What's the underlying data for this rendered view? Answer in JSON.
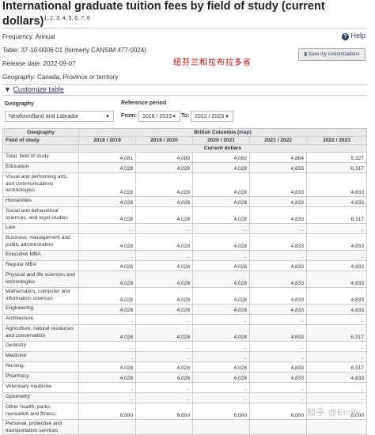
{
  "page": {
    "title": "International graduate tuition fees by field of study (current dollars)",
    "footnotes": "1, 2, 3, 4, 5, 6, 7, 8",
    "help_label": "Help",
    "frequency": "Frequency: Annual",
    "table_id": "Table: 37-10-0006-01 (formerly CANSIM 477-0024)",
    "release_date": "Release date: 2022-09-07",
    "geography_prefix": "Geography:",
    "geography_value": " Canada, Province or territory",
    "save_button": "Save my customizations",
    "chinese_annotation": "纽芬兰和拉布拉多省",
    "customize_label": "Customize table"
  },
  "filters": {
    "geography_label": "Geography",
    "geography_value": "Newfoundland and Labrador",
    "reference_label": "Reference period",
    "from_label": "From:",
    "from_value": "2018 / 2019",
    "to_label": "To:",
    "to_value": "2022 / 2023"
  },
  "table": {
    "geo_header": "Geography",
    "region": "British Columbia",
    "map_link": "(map)",
    "field_header": "Field of study",
    "years": [
      "2018 / 2019",
      "2019 / 2020",
      "2020 / 2021",
      "2021 / 2022",
      "2022 / 2023"
    ],
    "unit": "Current dollars",
    "rows": [
      {
        "label": "Total, field of study",
        "values": [
          "4,081",
          "4,089",
          "4,082",
          "4,864",
          "5,327"
        ]
      },
      {
        "label": "Education",
        "values": [
          "4,028",
          "4,028",
          "4,028",
          "4,833",
          "6,317"
        ]
      },
      {
        "label": "Visual and performing arts, and communications technologies",
        "values": [
          "4,028",
          "4,028",
          "4,028",
          "4,833",
          "4,833"
        ]
      },
      {
        "label": "Humanities",
        "values": [
          "4,028",
          "4,028",
          "4,028",
          "4,833",
          "4,833"
        ]
      },
      {
        "label": "Social and behavioural sciences, and legal studies",
        "values": [
          "4,028",
          "4,028",
          "4,028",
          "4,833",
          "6,317"
        ]
      },
      {
        "label": "Law",
        "values": [
          "..",
          "..",
          "..",
          "..",
          ".."
        ]
      },
      {
        "label": "Business, management and public administration",
        "values": [
          "4,028",
          "4,028",
          "4,028",
          "4,833",
          "4,833"
        ]
      },
      {
        "label": "Executive MBA",
        "values": [
          "..",
          "..",
          "..",
          "..",
          ".."
        ]
      },
      {
        "label": "Regular MBA",
        "values": [
          "4,028",
          "4,028",
          "4,028",
          "4,833",
          "4,833"
        ]
      },
      {
        "label": "Physical and life sciences and technologies",
        "values": [
          "4,028",
          "4,028",
          "4,028",
          "4,833",
          "4,833"
        ]
      },
      {
        "label": "Mathematics, computer and information sciences",
        "values": [
          "4,028",
          "4,028",
          "4,028",
          "4,833",
          "4,833"
        ]
      },
      {
        "label": "Engineering",
        "values": [
          "4,028",
          "4,028",
          "4,028",
          "4,833",
          "4,833"
        ]
      },
      {
        "label": "Architecture",
        "values": [
          "..",
          "..",
          "..",
          "..",
          ".."
        ]
      },
      {
        "label": "Agriculture, natural resources and conservation",
        "values": [
          "4,028",
          "4,028",
          "4,028",
          "4,833",
          "6,317"
        ]
      },
      {
        "label": "Dentistry",
        "values": [
          "..",
          "..",
          "..",
          "..",
          ".."
        ]
      },
      {
        "label": "Medicine",
        "values": [
          "..",
          "..",
          "..",
          "..",
          ".."
        ]
      },
      {
        "label": "Nursing",
        "values": [
          "4,028",
          "4,028",
          "4,028",
          "4,833",
          "6,317"
        ]
      },
      {
        "label": "Pharmacy",
        "values": [
          "4,028",
          "4,028",
          "4,028",
          "4,833",
          "4,833"
        ]
      },
      {
        "label": "Veterinary medicine",
        "values": [
          "..",
          "..",
          "..",
          "..",
          ".."
        ]
      },
      {
        "label": "Optometry",
        "values": [
          "..",
          "..",
          "..",
          "..",
          ".."
        ]
      },
      {
        "label": "Other health, parks, recreation and fitness",
        "values": [
          "6,000",
          "6,000",
          "6,000",
          "6,000",
          "6,000"
        ]
      },
      {
        "label": "Personal, protective and transportation services",
        "values": [
          "",
          "",
          "",
          "",
          ""
        ]
      }
    ]
  },
  "watermark": "知乎 @Emily"
}
